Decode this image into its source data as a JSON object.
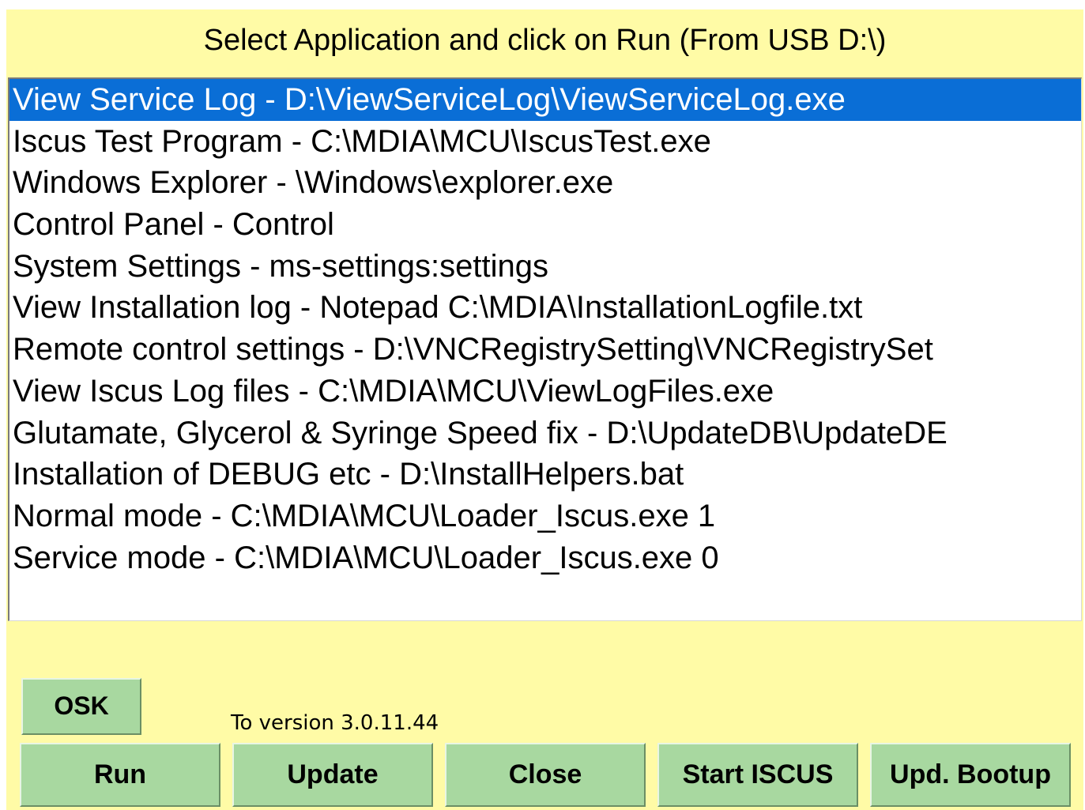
{
  "title": "Select Application and click on Run (From USB D:\\)",
  "applications": [
    {
      "label": "View Service Log - D:\\ViewServiceLog\\ViewServiceLog.exe",
      "selected": true
    },
    {
      "label": "Iscus Test Program - C:\\MDIA\\MCU\\IscusTest.exe",
      "selected": false
    },
    {
      "label": "Windows Explorer - \\Windows\\explorer.exe",
      "selected": false
    },
    {
      "label": "Control Panel - Control",
      "selected": false
    },
    {
      "label": "System Settings - ms-settings:settings",
      "selected": false
    },
    {
      "label": "View Installation log - Notepad C:\\MDIA\\InstallationLogfile.txt",
      "selected": false
    },
    {
      "label": "Remote control settings - D:\\VNCRegistrySetting\\VNCRegistrySet",
      "selected": false
    },
    {
      "label": "View Iscus Log files - C:\\MDIA\\MCU\\ViewLogFiles.exe",
      "selected": false
    },
    {
      "label": "Glutamate, Glycerol & Syringe Speed fix - D:\\UpdateDB\\UpdateDE",
      "selected": false
    },
    {
      "label": "Installation of DEBUG etc - D:\\InstallHelpers.bat",
      "selected": false
    },
    {
      "label": "Normal mode - C:\\MDIA\\MCU\\Loader_Iscus.exe 1",
      "selected": false
    },
    {
      "label": "Service mode - C:\\MDIA\\MCU\\Loader_Iscus.exe 0",
      "selected": false
    }
  ],
  "buttons": {
    "osk": "OSK",
    "run": "Run",
    "update": "Update",
    "close": "Close",
    "start_iscus": "Start ISCUS",
    "upd_bootup": "Upd. Bootup"
  },
  "version_text": "To version 3.0.11.44",
  "colors": {
    "panel_background": "#fffba6",
    "button_background": "#a8d8a0",
    "selection_background": "#0a6ed6"
  }
}
